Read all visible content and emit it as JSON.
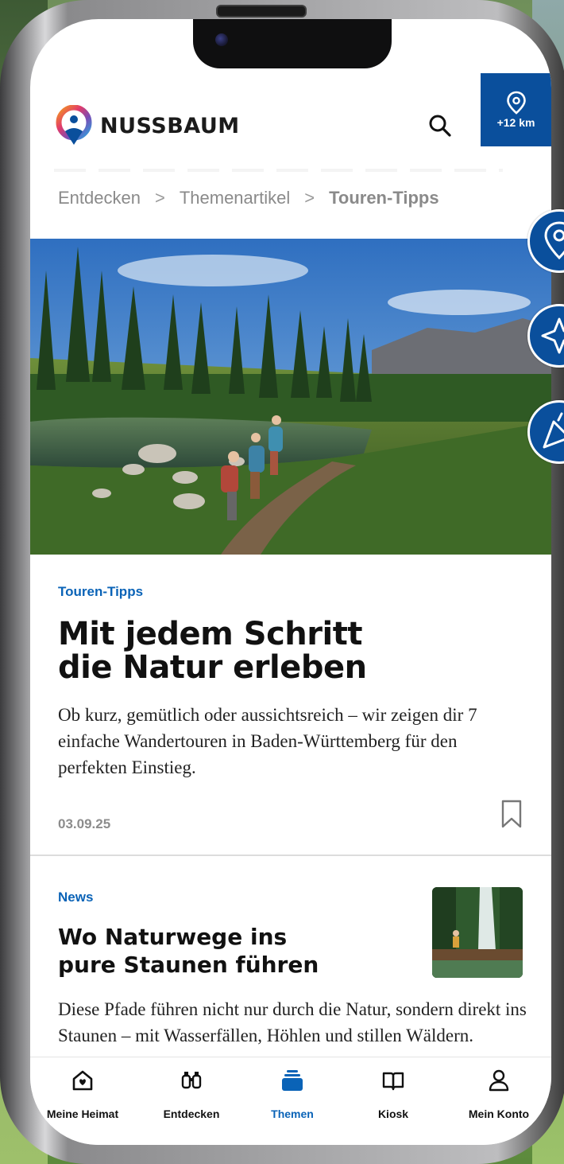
{
  "brand": {
    "name": "NUSSBAUM"
  },
  "header": {
    "location_badge": "+12 km"
  },
  "breadcrumb": {
    "items": [
      "Entdecken",
      "Themenartikel"
    ],
    "current": "Touren-Tipps",
    "separator": ">"
  },
  "article_main": {
    "kicker": "Touren-Tipps",
    "title_line1": "Mit jedem Schritt",
    "title_line2": "die Natur erleben",
    "teaser": "Ob kurz, gemütlich oder aussichtsreich – wir zeigen dir 7 einfache Wandertouren in Baden-Württemberg für den perfekten Einstieg.",
    "date": "03.09.25"
  },
  "article_second": {
    "kicker": "News",
    "title_line1": "Wo Naturwege ins",
    "title_line2": "pure Staunen führen",
    "teaser": "Diese Pfade führen nicht nur durch die Natur, sondern direkt ins Staunen – mit Wasserfällen, Höhlen und stillen Wäldern."
  },
  "bottom_nav": {
    "items": [
      {
        "label": "Meine Heimat",
        "icon": "home-heart-icon"
      },
      {
        "label": "Entdecken",
        "icon": "binoculars-icon"
      },
      {
        "label": "Themen",
        "icon": "stack-icon",
        "active": true
      },
      {
        "label": "Kiosk",
        "icon": "open-book-icon"
      },
      {
        "label": "Mein Konto",
        "icon": "person-icon"
      }
    ]
  },
  "side_actions": [
    "location-pin-icon",
    "sparkle-icon",
    "party-popper-icon"
  ],
  "colors": {
    "brand_blue": "#0a4f9c",
    "accent_blue": "#0a63b7",
    "text": "#111111",
    "muted": "#8a8a8a"
  }
}
